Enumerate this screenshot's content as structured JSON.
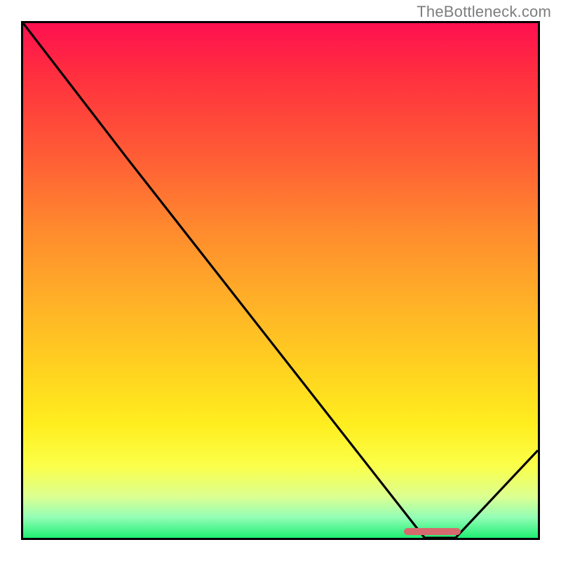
{
  "attribution": "TheBottleneck.com",
  "chart_data": {
    "type": "line",
    "title": "",
    "xlabel": "",
    "ylabel": "",
    "xlim": [
      0,
      100
    ],
    "ylim": [
      0,
      100
    ],
    "series": [
      {
        "name": "curve",
        "x": [
          0,
          20,
          78,
          84,
          100
        ],
        "y": [
          100,
          74,
          0,
          0,
          17
        ]
      }
    ],
    "annotations": [
      {
        "name": "optimal-range-marker",
        "type": "bar-segment",
        "x_start": 74,
        "x_end": 85,
        "y": 1.2,
        "color": "#d66a6e"
      }
    ],
    "background_gradient": {
      "direction": "vertical",
      "stops": [
        {
          "pos": 0.0,
          "color": "#ff1050"
        },
        {
          "pos": 0.1,
          "color": "#ff2f3f"
        },
        {
          "pos": 0.25,
          "color": "#ff5a36"
        },
        {
          "pos": 0.4,
          "color": "#ff8a2e"
        },
        {
          "pos": 0.55,
          "color": "#ffb327"
        },
        {
          "pos": 0.68,
          "color": "#ffd41f"
        },
        {
          "pos": 0.78,
          "color": "#ffee1f"
        },
        {
          "pos": 0.86,
          "color": "#fbff49"
        },
        {
          "pos": 0.92,
          "color": "#dcff91"
        },
        {
          "pos": 0.96,
          "color": "#93feb6"
        },
        {
          "pos": 1.0,
          "color": "#1fef73"
        }
      ]
    }
  }
}
